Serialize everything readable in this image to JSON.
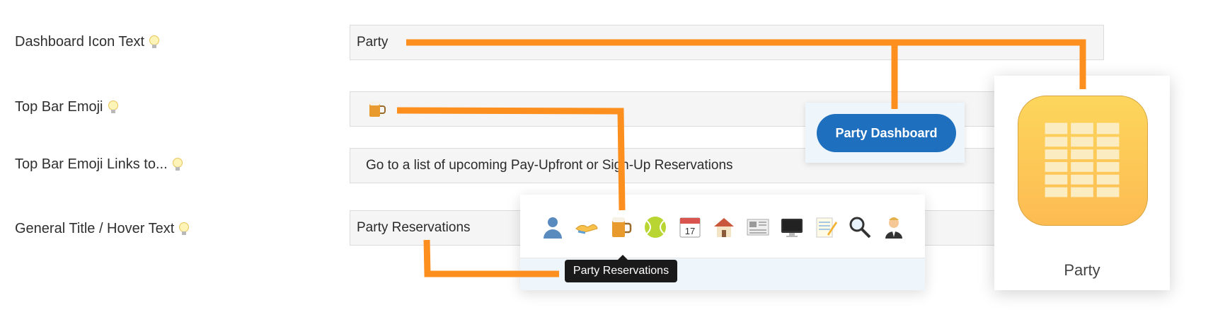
{
  "settings": {
    "rows": [
      {
        "label": "Dashboard Icon Text",
        "value": "Party"
      },
      {
        "label": "Top Bar Emoji",
        "value": ""
      },
      {
        "label": "Top Bar Emoji Links to...",
        "value": "Go to a list of upcoming Pay-Upfront or Sign-Up Reservations"
      },
      {
        "label": "General Title / Hover Text",
        "value": "Party Reservations"
      }
    ]
  },
  "preview": {
    "dashboard_button": "Party Dashboard",
    "app_icon_label": "Party",
    "tooltip": "Party Reservations",
    "topbar_emojis": [
      "person-icon",
      "handshake-icon",
      "beer-mug-icon",
      "tennis-ball-icon",
      "calendar-icon",
      "house-icon",
      "newspaper-icon",
      "desktop-icon",
      "memo-icon",
      "magnifier-icon",
      "person-tie-icon"
    ]
  },
  "colors": {
    "connector": "#fc8f1e",
    "button": "#1f6fbf",
    "app_icon": "#fdc857"
  }
}
